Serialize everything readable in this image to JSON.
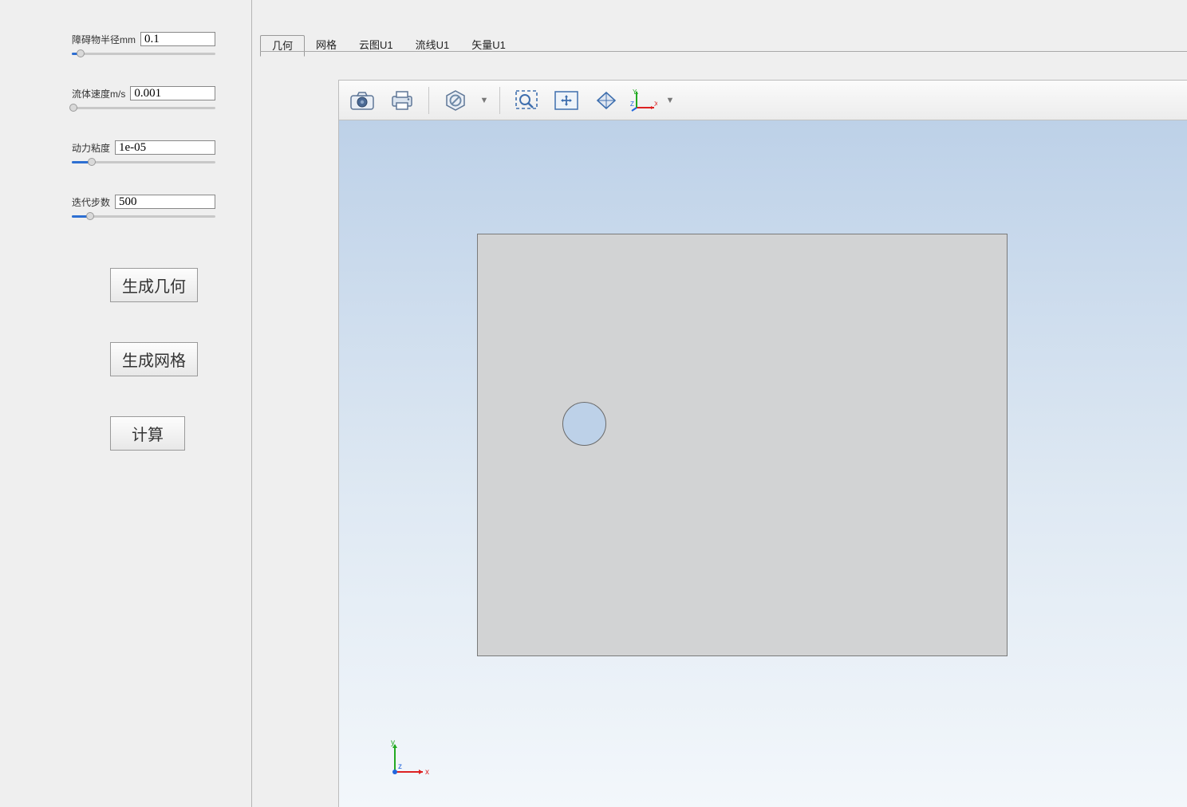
{
  "sidebar": {
    "params": [
      {
        "label": "障碍物半径mm",
        "value": "0.1",
        "fill_pct": 6
      },
      {
        "label": "流体速度m/s",
        "value": "0.001",
        "fill_pct": 1
      },
      {
        "label": "动力粘度",
        "value": "1e-05",
        "fill_pct": 14
      },
      {
        "label": "迭代步数",
        "value": "500",
        "fill_pct": 13
      }
    ],
    "buttons": {
      "gen_geometry": "生成几何",
      "gen_mesh": "生成网格",
      "compute": "计算"
    }
  },
  "tabs": [
    {
      "label": "几何",
      "active": true
    },
    {
      "label": "网格",
      "active": false
    },
    {
      "label": "云图U1",
      "active": false
    },
    {
      "label": "流线U1",
      "active": false
    },
    {
      "label": "矢量U1",
      "active": false
    }
  ],
  "toolbar": {
    "camera": "camera-icon",
    "print": "print-icon",
    "nodata": "nodata-icon",
    "zoom_box": "zoom-box-icon",
    "pan": "pan-icon",
    "rotate": "rotate-icon",
    "axes": "axes-icon"
  },
  "axes": {
    "x": "x",
    "y": "y",
    "z": "z",
    "X": "X",
    "Y": "Y",
    "Z": "Z"
  }
}
